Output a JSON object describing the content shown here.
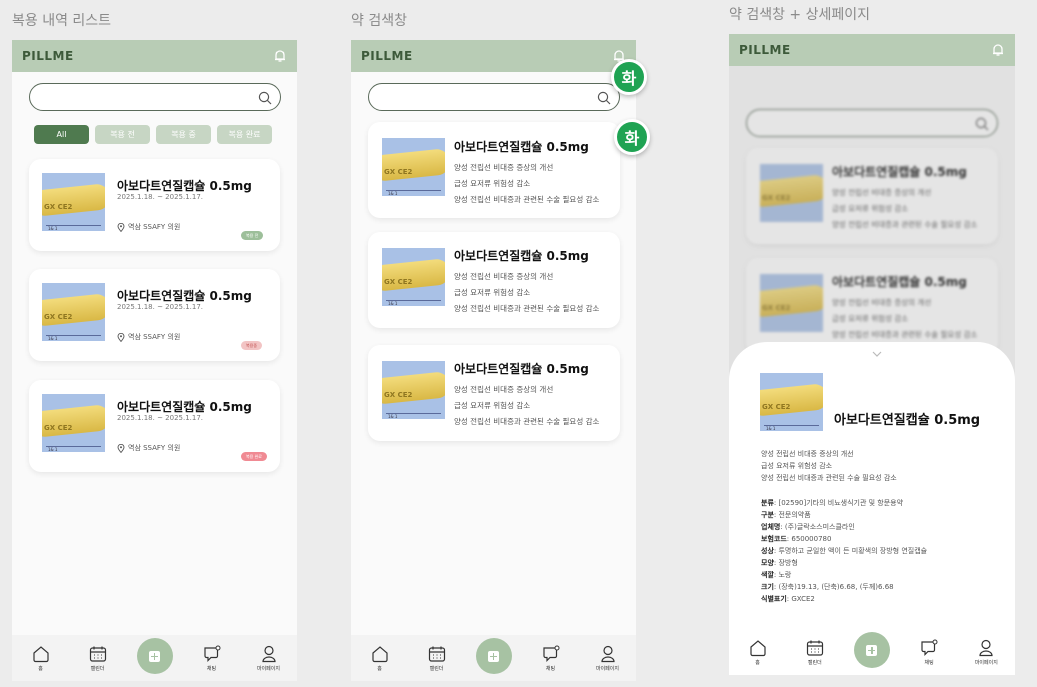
{
  "frames": {
    "list": {
      "title": "복용 내역 리스트"
    },
    "search": {
      "title": "약 검색창"
    },
    "detail": {
      "title": "약 검색창 + 상세페이지"
    }
  },
  "app": {
    "logo": "PILLME",
    "bell_icon": "bell-icon",
    "search_icon": "search-icon",
    "search_placeholder": ""
  },
  "filters": [
    "All",
    "복용 전",
    "복용 중",
    "복용 완료"
  ],
  "drug": {
    "name": "아보다트연질캡슐 0.5mg",
    "imprint": "GX CE2",
    "scale": "1& 1",
    "effects": [
      "양성 전립선 비대증 증상의 개선",
      "급성 요저류 위험성 감소",
      "양성 전립선 비대증과 관련된 수술 필요성 감소"
    ]
  },
  "history": [
    {
      "period": "2025.1.18. ~ 2025.1.17.",
      "location": "역삼 SSAFY 의원",
      "status": "복용 전",
      "status_color": "#9dbf9a"
    },
    {
      "period": "2025.1.18. ~ 2025.1.17.",
      "location": "역삼 SSAFY 의원",
      "status": "복용중",
      "status_color": "#f2c4c4"
    },
    {
      "period": "2025.1.18. ~ 2025.1.17.",
      "location": "역삼 SSAFY 의원",
      "status": "복용 완료",
      "status_color": "#f08a93"
    }
  ],
  "float_buttons": [
    "화",
    "화"
  ],
  "nav": [
    {
      "label": "홈",
      "icon": "home-icon"
    },
    {
      "label": "캘린더",
      "icon": "calendar-icon"
    },
    {
      "label": "",
      "icon": "add-icon"
    },
    {
      "label": "채팅",
      "icon": "chat-icon"
    },
    {
      "label": "마이페이지",
      "icon": "profile-icon"
    }
  ],
  "detail": {
    "chevron_icon": "chevron-down-icon",
    "fields": [
      {
        "label": "분류",
        "value": "[02590]기타의 비뇨생식기관 및 항문용약"
      },
      {
        "label": "구분",
        "value": "전문의약품"
      },
      {
        "label": "업체명",
        "value": "(주)글락소스미스클라인"
      },
      {
        "label": "보험코드",
        "value": "650000780"
      },
      {
        "label": "성상",
        "value": "투명하고 균일한 액이 든 미황색의 장방형 연질캡슐"
      },
      {
        "label": "모양",
        "value": "장방형"
      },
      {
        "label": "색깔",
        "value": "노랑"
      },
      {
        "label": "크기",
        "value": "(장축)19.13, (단축)6.68, (두께)6.68"
      },
      {
        "label": "식별표기",
        "value": "GXCE2"
      }
    ]
  }
}
